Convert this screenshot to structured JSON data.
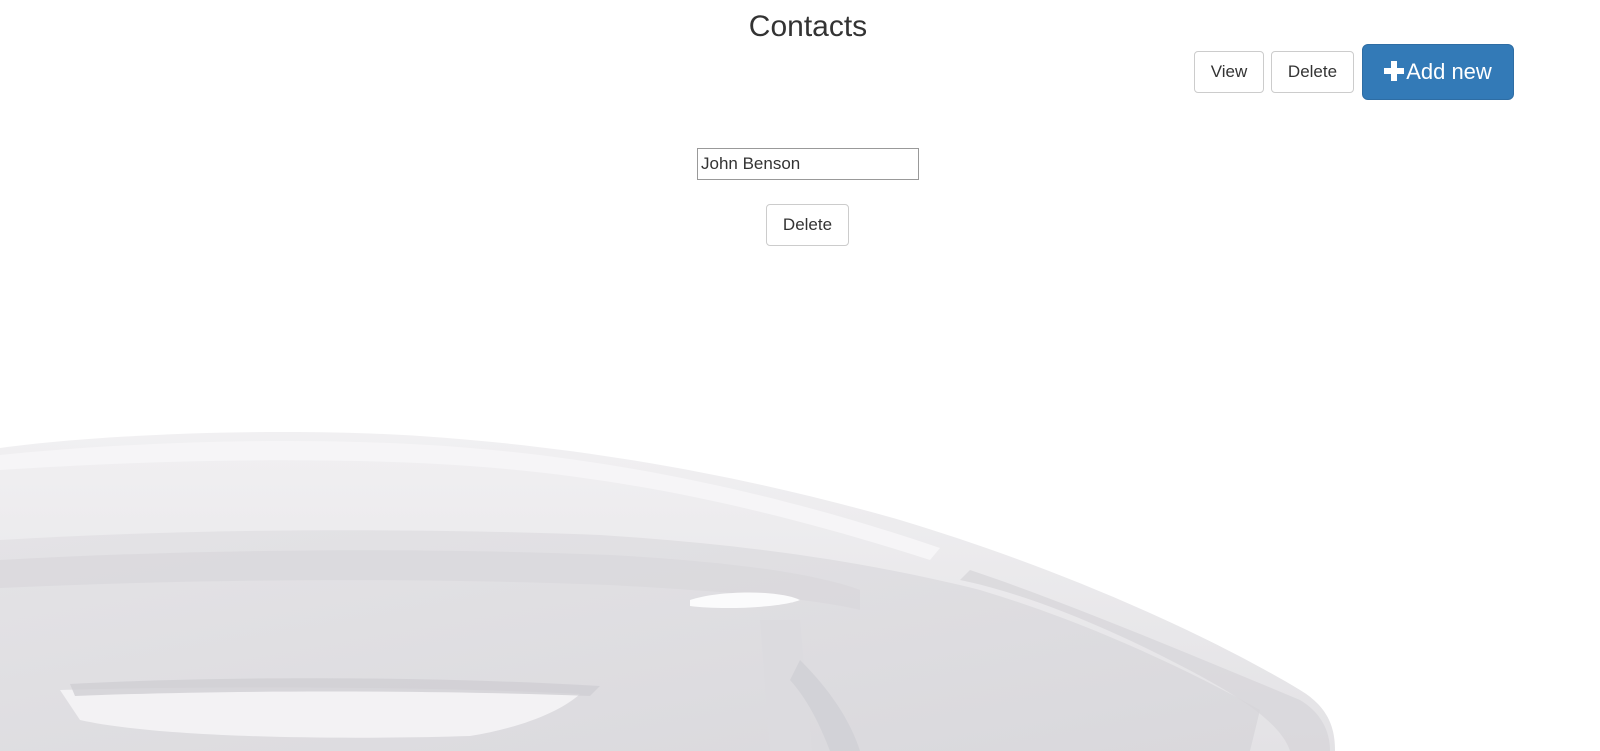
{
  "header": {
    "title": "Contacts"
  },
  "toolbar": {
    "view_label": "View",
    "delete_label": "Delete",
    "add_label": "Add new",
    "add_icon": "plus-icon",
    "accent_color": "#337ab7"
  },
  "form": {
    "contact_name_value": "John Benson",
    "delete_label": "Delete"
  },
  "background": {
    "image": "telephone-handset"
  }
}
